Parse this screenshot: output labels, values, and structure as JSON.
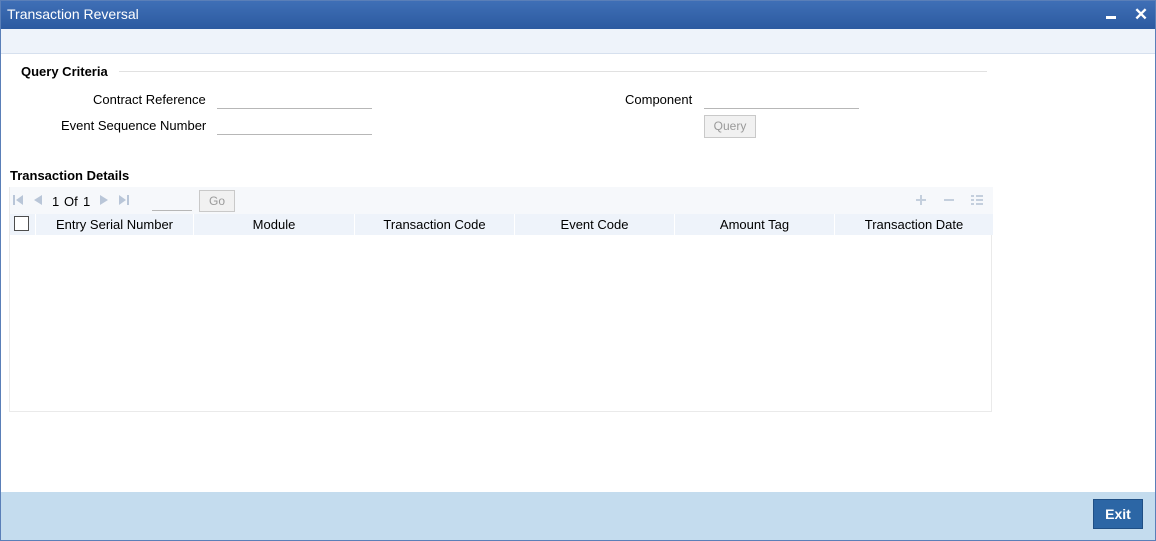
{
  "window": {
    "title": "Transaction Reversal",
    "minimize_icon": "minimize-icon",
    "close_icon": "close-icon"
  },
  "query_criteria": {
    "heading": "Query Criteria",
    "contract_reference_label": "Contract Reference",
    "contract_reference_value": "",
    "event_sequence_label": "Event Sequence Number",
    "event_sequence_value": "",
    "component_label": "Component",
    "component_value": "",
    "query_button": "Query"
  },
  "transaction_details": {
    "heading": "Transaction Details",
    "pagination": {
      "current": "1",
      "of_label": "Of",
      "total": "1",
      "go_button": "Go"
    },
    "columns": [
      "Entry Serial Number",
      "Module",
      "Transaction Code",
      "Event Code",
      "Amount Tag",
      "Transaction Date"
    ],
    "rows": []
  },
  "footer": {
    "exit_button": "Exit"
  },
  "colors": {
    "titlebar": "#2c5aa0",
    "footer": "#c4dcee",
    "exit_button": "#2c66a5"
  }
}
